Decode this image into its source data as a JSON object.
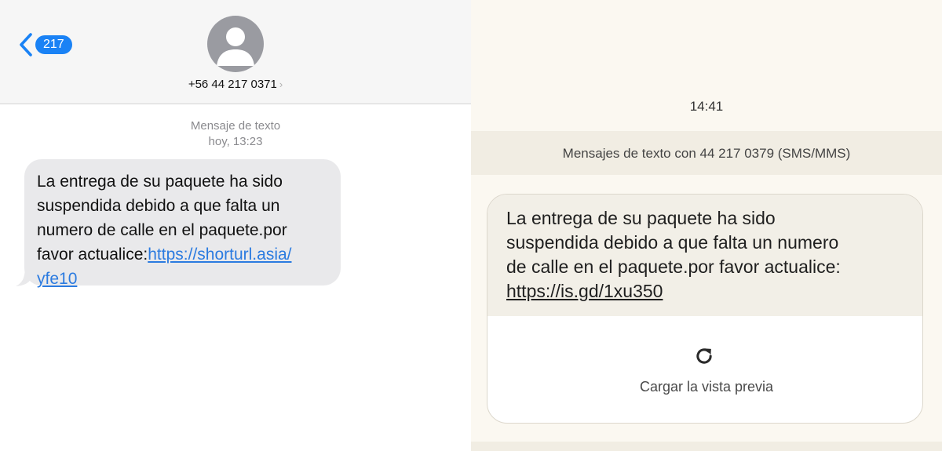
{
  "ios": {
    "back_badge": "217",
    "contact_number": "+56 44 217 0371",
    "contact_chevron": "›",
    "meta_line1": "Mensaje de texto",
    "meta_line2": "hoy, 13:23",
    "bubble_line1": "La entrega de su paquete ha sido",
    "bubble_line2": "suspendida debido a que falta un",
    "bubble_line3": "numero de calle en el paquete.por",
    "bubble_line4_text": "favor actualice:",
    "bubble_link_part1": "https://shorturl.asia/",
    "bubble_link_part2": "yfe10",
    "icons": {
      "back": "chevron-left-icon",
      "avatar": "person-silhouette-icon"
    },
    "colors": {
      "accent": "#1a82f5",
      "bubble_bg": "#e9e9eb",
      "link": "#2b7be0"
    }
  },
  "android": {
    "time": "14:41",
    "conversation_label": "Mensajes de texto con 44 217 0379 (SMS/MMS)",
    "msg_line1": "La entrega de su paquete ha sido",
    "msg_line2": "suspendida debido a que falta un numero",
    "msg_line3": "de calle en el paquete.por favor actualice:",
    "msg_link": "https://is.gd/1xu350",
    "preview_label": "Cargar la vista previa",
    "icons": {
      "preview": "refresh-icon"
    },
    "colors": {
      "background": "#fbf8f1",
      "message_bg": "#f2efe7"
    }
  }
}
